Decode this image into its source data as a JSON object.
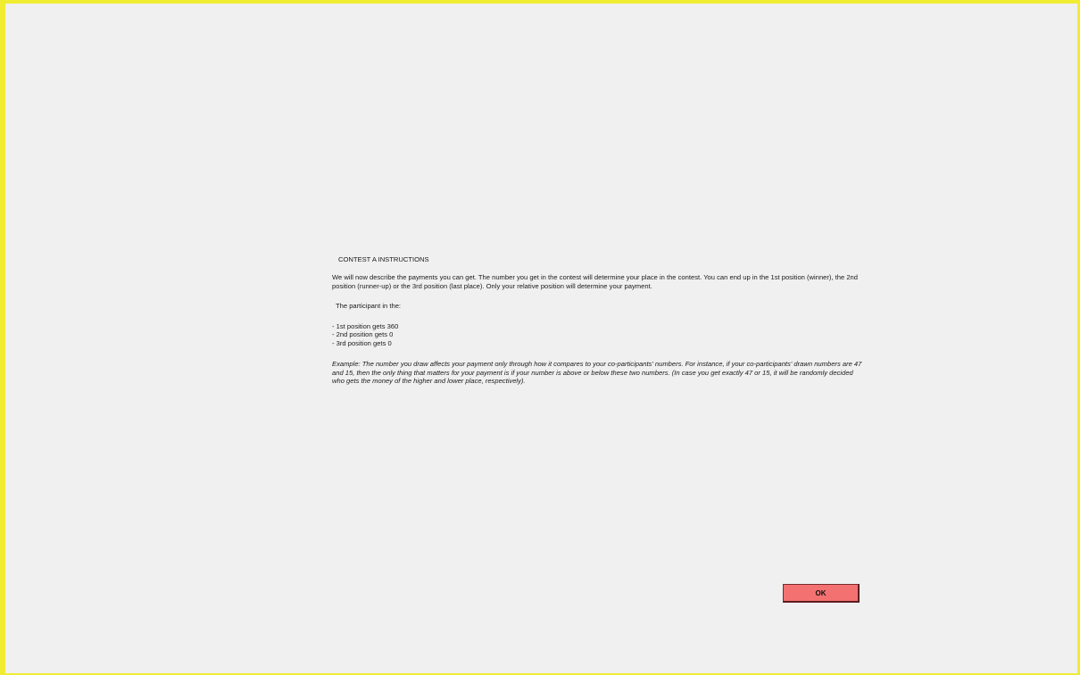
{
  "screen": {
    "title": "CONTEST A  INSTRUCTIONS",
    "intro": "We will now describe the payments you can get. The number you get in the contest will determine your place in the contest. You can end up in the 1st position (winner), the 2nd position (runner-up) or the 3rd position (last place). Only your relative position will determine your payment.",
    "participant_label": "The participant in the:",
    "positions": [
      "- 1st position gets 360",
      "- 2nd position gets 0",
      "- 3rd position gets 0"
    ],
    "example": "Example: The number you draw affects your payment only through how it compares to your co-participants' numbers. For instance, if your co-participants' drawn numbers are 47 and 15, then the only thing that matters for your payment is if your number is above or below these two numbers. (In case you get exactly 47 or 15, it will be randomly decided who gets the money of the higher and lower place, respectively).",
    "ok_label": "OK"
  },
  "colors": {
    "frame_border": "#f0ec32",
    "background": "#f0f0f0",
    "ok_button": "#f47171"
  }
}
